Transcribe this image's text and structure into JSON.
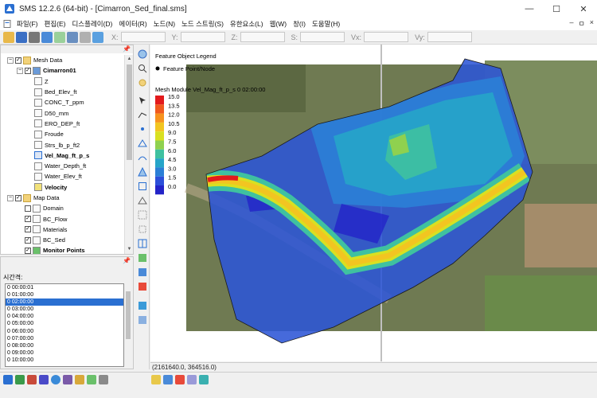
{
  "window": {
    "title": "SMS 12.2.6 (64-bit) - [Cimarron_Sed_final.sms]",
    "minimize": "—",
    "maximize": "☐",
    "close": "✕"
  },
  "menu": {
    "items": [
      "파일(F)",
      "편집(E)",
      "디스플레이(D)",
      "에이터(R)",
      "노드(N)",
      "노드 스트링(S)",
      "유한요소(L)",
      "웹(W)",
      "창(I)",
      "도움말(H)"
    ],
    "right_controls": [
      "–",
      "ㅁ",
      "×"
    ]
  },
  "toolbar": {
    "coord_labels": [
      "X:",
      "Y:",
      "Z:",
      "S:",
      "Vx:",
      "Vy:"
    ]
  },
  "tree": {
    "nodes": [
      {
        "label": "Mesh Data",
        "bold": false
      },
      {
        "label": "Cimarron01",
        "bold": true
      },
      {
        "label": "Z",
        "bold": false
      },
      {
        "label": "Bed_Elev_ft",
        "bold": false
      },
      {
        "label": "CONC_T_ppm",
        "bold": false
      },
      {
        "label": "D50_mm",
        "bold": false
      },
      {
        "label": "ERO_DEP_ft",
        "bold": false
      },
      {
        "label": "Froude",
        "bold": false
      },
      {
        "label": "Strs_lb_p_ft2",
        "bold": false
      },
      {
        "label": "Vel_Mag_ft_p_s",
        "bold": true
      },
      {
        "label": "Water_Depth_ft",
        "bold": false
      },
      {
        "label": "Water_Elev_ft",
        "bold": false
      },
      {
        "label": "Velocity",
        "bold": true
      },
      {
        "label": "Map Data",
        "bold": false
      },
      {
        "label": "Domain",
        "bold": false
      },
      {
        "label": "BC_Flow",
        "bold": false
      },
      {
        "label": "Materials",
        "bold": false
      },
      {
        "label": "BC_Sed",
        "bold": false
      },
      {
        "label": "Monitor Points",
        "bold": true
      }
    ]
  },
  "time_panel": {
    "label": "시간격:",
    "steps": [
      "0 00:00:01",
      "0 01:00:00",
      "0 02:00:00",
      "0 03:00:00",
      "0 04:00:00",
      "0 05:00:00",
      "0 06:00:00",
      "0 07:00:00",
      "0 08:00:00",
      "0 09:00:00",
      "0 10:00:00"
    ],
    "selected_index": 2
  },
  "legend": {
    "feature_title": "Feature Object Legend",
    "feature_item": "Feature Point/Node",
    "contour_title": "Mesh Module Vel_Mag_ft_p_s 0 02:00:00",
    "levels": [
      "15.0",
      "13.5",
      "12.0",
      "10.5",
      "9.0",
      "7.5",
      "6.0",
      "4.5",
      "3.0",
      "1.5",
      "0.0"
    ],
    "colors": [
      "#e31a1c",
      "#f05a1e",
      "#f7931e",
      "#f2c521",
      "#d9e021",
      "#8fd14f",
      "#3fc1a0",
      "#26a5c9",
      "#2b7fd6",
      "#2c4fd9",
      "#2323c8"
    ]
  },
  "status": {
    "coords": "(2161640.0, 364516.0)"
  }
}
